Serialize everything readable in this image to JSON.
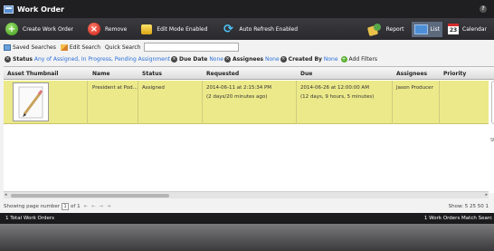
{
  "window": {
    "title": "Work Order",
    "help_label": "?"
  },
  "toolbar": {
    "create_label": "Create Work Order",
    "remove_label": "Remove",
    "edit_mode_label": "Edit Mode Enabled",
    "auto_refresh_label": "Auto Refresh Enabled",
    "report_label": "Report",
    "list_label": "List",
    "calendar_label": "Calendar",
    "calendar_day": "23"
  },
  "search": {
    "saved_label": "Saved Searches",
    "edit_label": "Edit Search",
    "quick_label": "Quick Search",
    "quick_value": ""
  },
  "filters": {
    "status_label": "Status",
    "status_value": "Any of Assigned, In Progress, Pending Assignment",
    "due_label": "Due Date",
    "due_value": "None",
    "assignees_label": "Assignees",
    "assignees_value": "None",
    "created_label": "Created By",
    "created_value": "None",
    "add_filters_label": "Add Filters"
  },
  "table": {
    "headers": [
      "Asset Thumbnail",
      "Name",
      "Status",
      "Requested",
      "Due",
      "Assignees",
      "Priority"
    ],
    "rows": [
      {
        "name": "President at Pod...",
        "status": "Assigned",
        "requested": "2014-06-11 at 2:15:34 PM",
        "requested_ago": "(2 days/20 minutes ago)",
        "due": "2014-06-26 at 12:00:00 AM",
        "due_in": "(12 days, 9 hours, 5 minutes)",
        "assignee": "Jason Producer",
        "priority": ""
      }
    ],
    "side_fragment": "St"
  },
  "pager": {
    "showing_label": "Showing page number",
    "page_value": "1",
    "of_label": "of 1",
    "nav": "⇤ ← → ⇥",
    "show_label": "Show: 5 25 50 1"
  },
  "status_bar": {
    "total": "1 Total Work Orders",
    "match": "1 Work Orders Match Searc"
  }
}
